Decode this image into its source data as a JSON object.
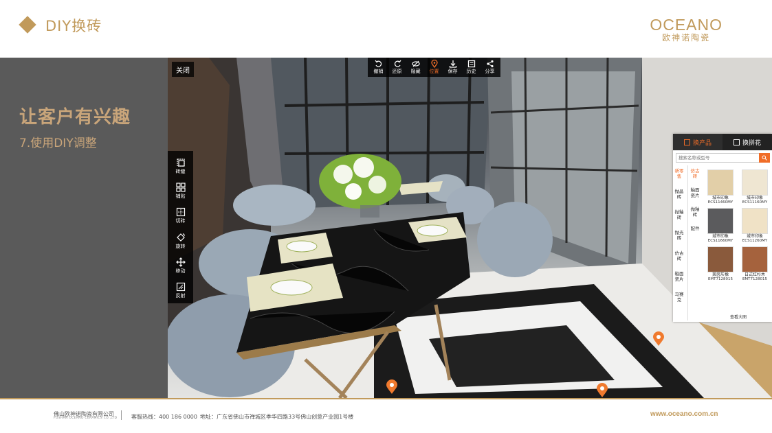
{
  "header": {
    "title": "DIY换砖"
  },
  "logo": {
    "brand": "OCEANO",
    "sub": "欧神诺陶瓷"
  },
  "intro": {
    "heading": "让客户有兴趣",
    "subheading": "7.使用DIY调整"
  },
  "viewer": {
    "close_label": "关闭",
    "top_tools": [
      {
        "icon": "undo-icon",
        "label": "撤销"
      },
      {
        "icon": "redo-icon",
        "label": "还原"
      },
      {
        "icon": "hide-icon",
        "label": "隐藏"
      },
      {
        "icon": "location-pin-icon",
        "label": "位置",
        "active": true
      },
      {
        "icon": "download-icon",
        "label": "保存"
      },
      {
        "icon": "history-icon",
        "label": "历史"
      },
      {
        "icon": "share-icon",
        "label": "分享"
      }
    ],
    "side_tools": [
      {
        "icon": "tile-gap-icon",
        "label": "砖缝"
      },
      {
        "icon": "paving-icon",
        "label": "铺贴"
      },
      {
        "icon": "cut-tile-icon",
        "label": "切砖"
      },
      {
        "icon": "rotate-icon",
        "label": "旋转"
      },
      {
        "icon": "move-icon",
        "label": "移动"
      },
      {
        "icon": "reflect-icon",
        "label": "反射"
      }
    ]
  },
  "product_panel": {
    "tabs": [
      {
        "label": "换产品",
        "active": true
      },
      {
        "label": "换拼花",
        "active": false
      }
    ],
    "search_placeholder": "搜索名称或型号",
    "categories_primary": [
      {
        "label": "新零售",
        "active": true
      },
      {
        "label": "抛晶砖"
      },
      {
        "label": "抛釉砖"
      },
      {
        "label": "抛光砖"
      },
      {
        "label": "仿古砖"
      },
      {
        "label": "釉面瓷片"
      },
      {
        "label": "马赛克"
      }
    ],
    "categories_secondary": [
      {
        "label": "仿古砖",
        "active": true
      },
      {
        "label": "釉面瓷片"
      },
      {
        "label": "抛釉砖"
      },
      {
        "label": "配件"
      }
    ],
    "products": [
      {
        "name": "城市印象",
        "code": "ECS11460MY",
        "color": "#e2cfa8"
      },
      {
        "name": "城市印象",
        "code": "ECS11160MY",
        "color": "#efe6d2"
      },
      {
        "name": "城市印象",
        "code": "ECS11660MY",
        "color": "#5b5b5d"
      },
      {
        "name": "城市印象",
        "code": "ECS11260MY",
        "color": "#f0e2c6"
      },
      {
        "name": "莱茵灰橡",
        "code": "EMT7128015",
        "color": "#8a5a3c"
      },
      {
        "name": "日式红杉木",
        "code": "EMT7128015",
        "color": "#a5623d"
      }
    ],
    "more_label": "查看大图"
  },
  "footer": {
    "company": "佛山欧神诺陶瓷有限公司",
    "company_en": "FOSHAN OCEANO CERAMICS CO.,LTD",
    "hotline": "客服热线：400 186 0000",
    "address": "地址：广东省佛山市禅城区季华四路33号佛山创意产业园1号楼",
    "website": "www.oceano.com.cn"
  },
  "colors": {
    "brand_gold": "#c19a5b",
    "accent_orange": "#f06d28",
    "panel_gray": "#5a5a5a"
  }
}
